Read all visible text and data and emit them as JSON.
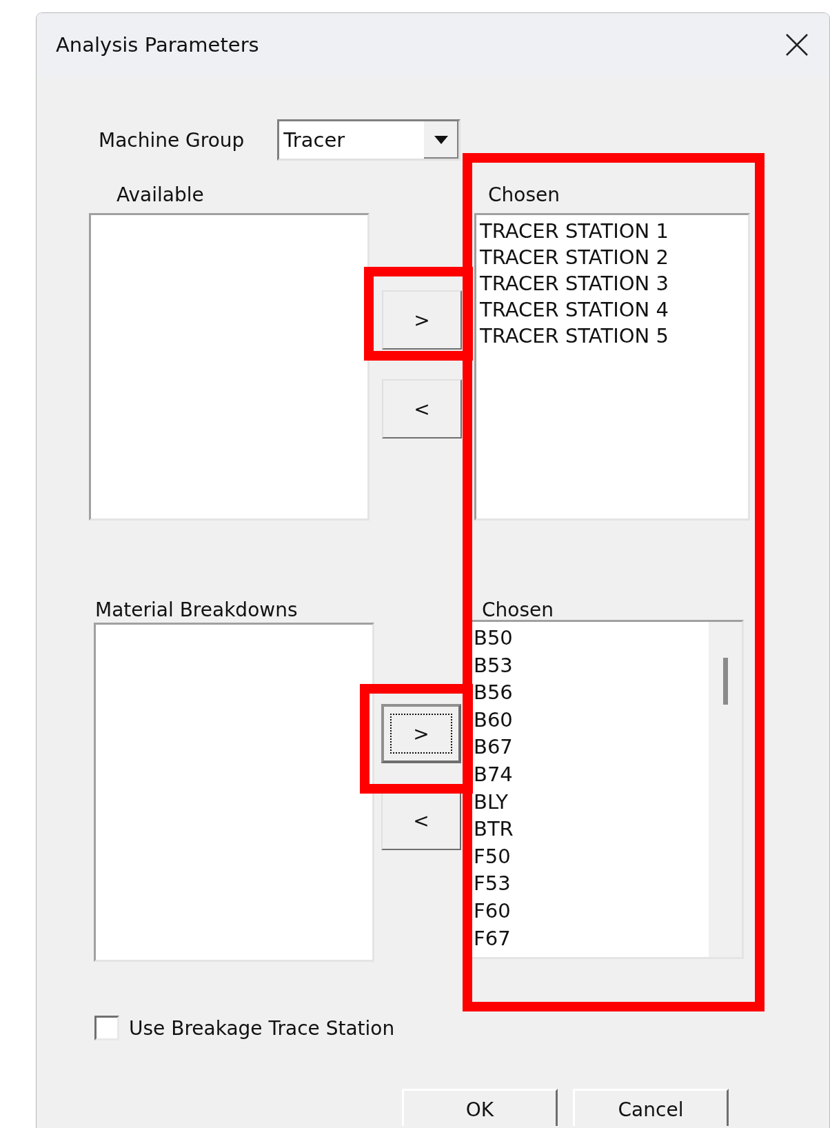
{
  "window": {
    "title": "Analysis Parameters"
  },
  "machine_group": {
    "label": "Machine Group",
    "value": "Tracer"
  },
  "machines": {
    "available_label": "Available",
    "add_button": {
      "label": ">",
      "focused": false
    },
    "remove_button": {
      "label": "<",
      "focused": false
    },
    "chosen_label": "Chosen",
    "chosen_items": [
      "TRACER STATION 1",
      "TRACER STATION 2",
      "TRACER STATION 3",
      "TRACER STATION 4",
      "TRACER STATION 5"
    ]
  },
  "materials": {
    "available_label": "Material Breakdowns",
    "add_button": {
      "label": ">",
      "focused": true
    },
    "remove_button": {
      "label": "<",
      "focused": false
    },
    "chosen_label": "Chosen",
    "chosen_items": [
      "B50",
      "B53",
      "B56",
      "B60",
      "B67",
      "B74",
      "BLY",
      "BTR",
      "F50",
      "F53",
      "F60",
      "F67"
    ]
  },
  "checkbox": {
    "label": "Use Breakage Trace Station",
    "checked": false
  },
  "buttons": [
    "OK",
    "Cancel"
  ]
}
